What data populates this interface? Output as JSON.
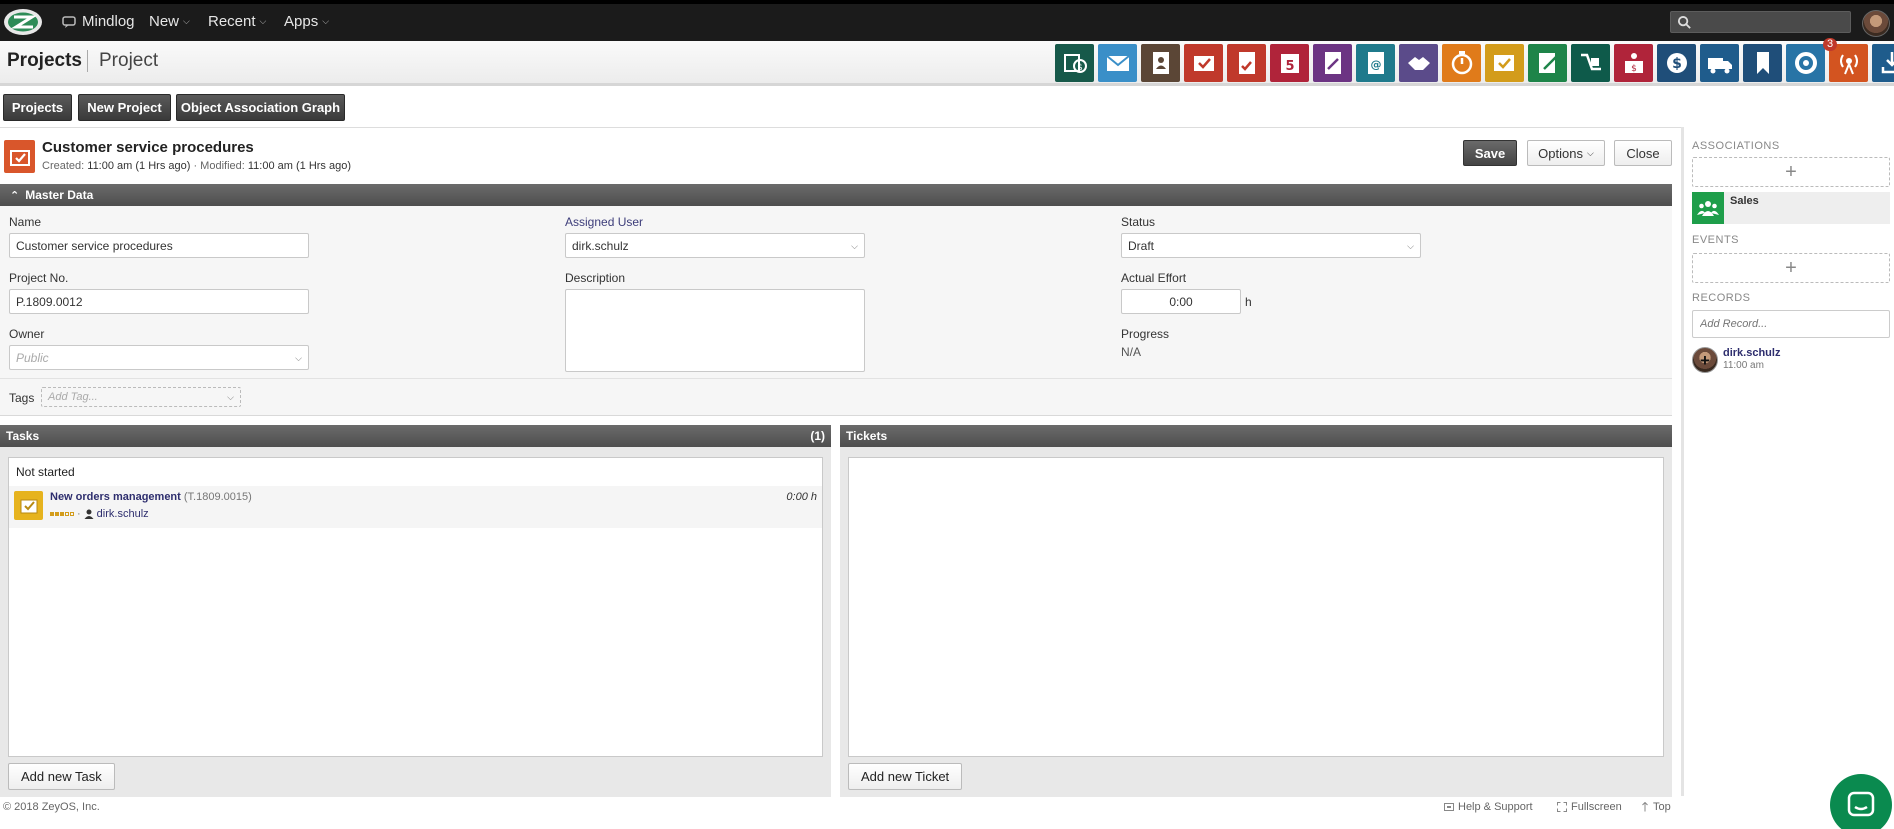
{
  "topbar": {
    "nav": [
      {
        "label": "Mindlog",
        "icon": "mindlog-icon"
      },
      {
        "label": "New"
      },
      {
        "label": "Recent"
      },
      {
        "label": "Apps"
      }
    ],
    "search_placeholder": ""
  },
  "header": {
    "breadcrumb_root": "Projects",
    "breadcrumb_current": "Project",
    "app_icons": [
      {
        "name": "billing-icon",
        "color": "#17594a"
      },
      {
        "name": "mail-icon",
        "color": "#3a8fc8"
      },
      {
        "name": "contacts-icon",
        "color": "#5b4636"
      },
      {
        "name": "tasks-icon",
        "color": "#c0392b"
      },
      {
        "name": "documents-icon",
        "color": "#c0392b"
      },
      {
        "name": "calendar-icon",
        "color": "#b0243a"
      },
      {
        "name": "contracts-icon",
        "color": "#6c3483"
      },
      {
        "name": "address-icon",
        "color": "#1f7a8c"
      },
      {
        "name": "deals-icon",
        "color": "#5b4b8a"
      },
      {
        "name": "timer-icon",
        "color": "#e07b1a"
      },
      {
        "name": "projects-icon",
        "color": "#d39c1b"
      },
      {
        "name": "notes-icon",
        "color": "#1e8449"
      },
      {
        "name": "shipping-icon",
        "color": "#0e5a4a"
      },
      {
        "name": "cashier-icon",
        "color": "#b0243a"
      },
      {
        "name": "payments-icon",
        "color": "#1f4e79"
      },
      {
        "name": "delivery-icon",
        "color": "#1f5c8c"
      },
      {
        "name": "bookmarks-icon",
        "color": "#1f4e79"
      },
      {
        "name": "support-icon",
        "color": "#2874a6"
      },
      {
        "name": "broadcast-icon",
        "color": "#d35420"
      },
      {
        "name": "download-icon",
        "color": "#1f5c8c"
      }
    ],
    "notification_badge": "3"
  },
  "actions": {
    "projects": "Projects",
    "new_project": "New Project",
    "association_graph": "Object Association Graph"
  },
  "record": {
    "title": "Customer service procedures",
    "created_label": "Created:",
    "created_value": "11:00 am (1 Hrs ago)",
    "modified_label": "· Modified:",
    "modified_value": "11:00 am (1 Hrs ago)",
    "save": "Save",
    "options": "Options",
    "close": "Close"
  },
  "master_data": {
    "header": "Master Data",
    "name_label": "Name",
    "name_value": "Customer service procedures",
    "project_no_label": "Project No.",
    "project_no_value": "P.1809.0012",
    "owner_label": "Owner",
    "owner_placeholder": "Public",
    "assigned_user_label": "Assigned User",
    "assigned_user_value": "dirk.schulz",
    "description_label": "Description",
    "description_value": "",
    "status_label": "Status",
    "status_value": "Draft",
    "actual_effort_label": "Actual Effort",
    "actual_effort_value": "0:00",
    "actual_effort_unit": "h",
    "progress_label": "Progress",
    "progress_value": "N/A",
    "tags_label": "Tags",
    "tags_placeholder": "Add Tag..."
  },
  "tasks": {
    "header": "Tasks",
    "count": "(1)",
    "group_label": "Not started",
    "items": [
      {
        "name": "New orders management",
        "number": "(T.1809.0015)",
        "effort": "0:00 h",
        "user": "dirk.schulz",
        "priority": 3,
        "priority_max": 5
      }
    ],
    "add_button": "Add new Task"
  },
  "tickets": {
    "header": "Tickets",
    "add_button": "Add new Ticket"
  },
  "sidebar": {
    "associations_header": "ASSOCIATIONS",
    "association_items": [
      {
        "label": "Sales",
        "color": "#1e9e4a"
      }
    ],
    "events_header": "EVENTS",
    "records_header": "RECORDS",
    "add_record_placeholder": "Add Record...",
    "record_items": [
      {
        "user": "dirk.schulz",
        "time": "11:00 am"
      }
    ]
  },
  "footer": {
    "copyright": "© 2018 ZeyOS, Inc.",
    "help": "Help & Support",
    "fullscreen": "Fullscreen",
    "top": "Top"
  }
}
